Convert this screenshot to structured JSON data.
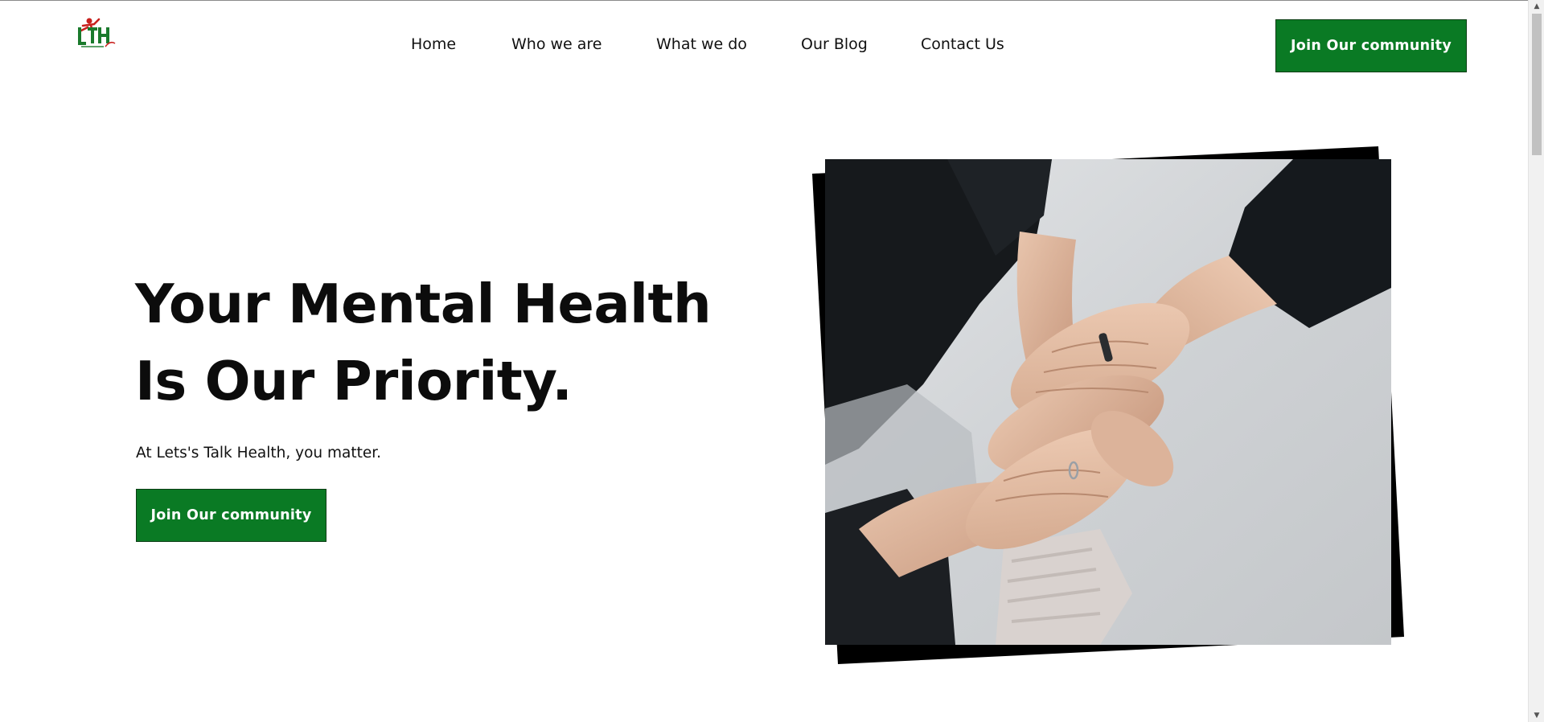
{
  "brand": {
    "logo_text": "LTH",
    "logo_tagline": "HEALTH FIRST"
  },
  "nav": {
    "items": [
      {
        "label": "Home"
      },
      {
        "label": "Who we are"
      },
      {
        "label": "What we do"
      },
      {
        "label": "Our Blog"
      },
      {
        "label": "Contact Us"
      }
    ],
    "cta_label": "Join Our community"
  },
  "hero": {
    "title_line1": "Your Mental Health",
    "title_line2": "Is Our Priority.",
    "subtitle": "At Lets's Talk Health, you matter.",
    "cta_label": "Join Our community",
    "image_description": "hands-stacked-photo"
  },
  "colors": {
    "accent": "#0a7a24",
    "accent_border": "#0b3d14",
    "text": "#111111",
    "background": "#ffffff"
  },
  "icons": {
    "scroll_up": "arrow-up-icon",
    "scroll_down": "arrow-down-icon"
  }
}
